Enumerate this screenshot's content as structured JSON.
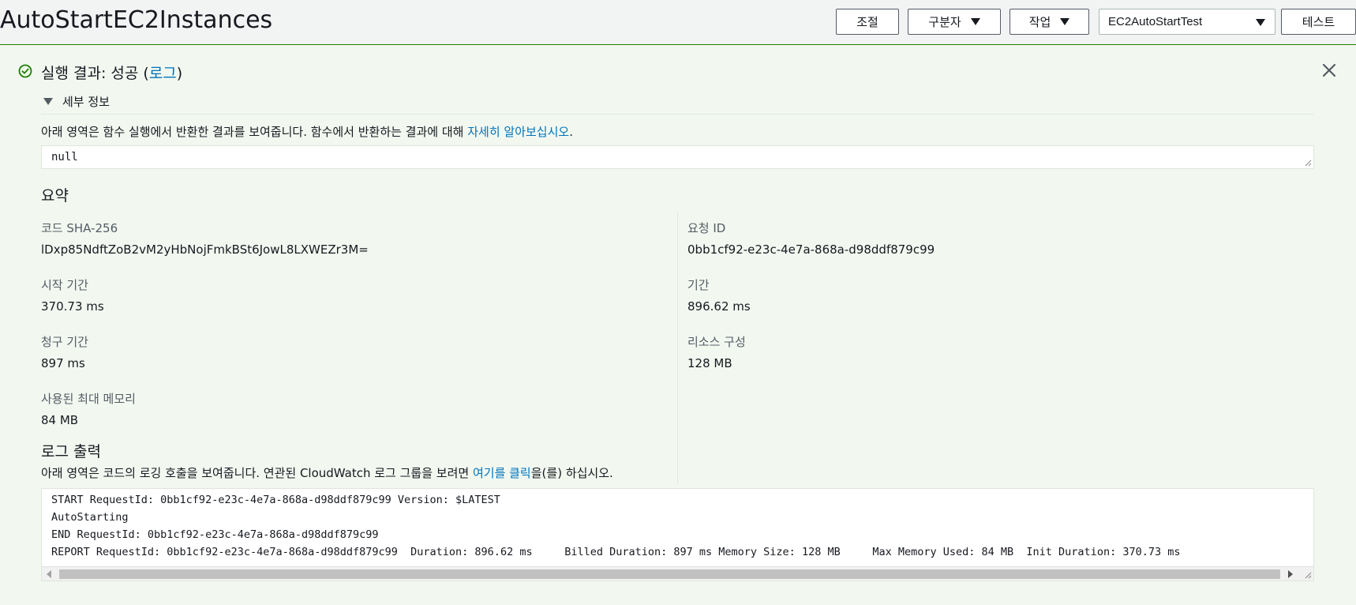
{
  "header": {
    "function_name": "AutoStartEC2Instances",
    "throttle_label": "조절",
    "qualifiers_label": "구분자",
    "actions_label": "작업",
    "test_event_value": "EC2AutoStartTest",
    "test_label": "테스트"
  },
  "result": {
    "title_prefix": "실행 결과: 성공 (",
    "log_link": "로그",
    "title_suffix": ")",
    "details_label": "세부 정보",
    "return_desc_prefix": "아래 영역은 함수 실행에서 반환한 결과를 보여줍니다. 함수에서 반환하는 결과에 대해 ",
    "return_desc_link": "자세히 알아보십시오",
    "return_desc_suffix": ".",
    "return_value": "null"
  },
  "summary": {
    "heading": "요약",
    "left": [
      {
        "label": "코드 SHA-256",
        "value": "lDxp85NdftZoB2vM2yHbNojFmkBSt6JowL8LXWEZr3M="
      },
      {
        "label": "시작 기간",
        "value": "370.73 ms"
      },
      {
        "label": "청구 기간",
        "value": "897 ms"
      },
      {
        "label": "사용된 최대 메모리",
        "value": "84 MB"
      }
    ],
    "right": [
      {
        "label": "요청 ID",
        "value": "0bb1cf92-e23c-4e7a-868a-d98ddf879c99"
      },
      {
        "label": "기간",
        "value": "896.62 ms"
      },
      {
        "label": "리소스 구성",
        "value": "128 MB"
      }
    ]
  },
  "log_output": {
    "heading": "로그 출력",
    "desc_prefix": "아래 영역은 코드의 로깅 호출을 보여줍니다. 연관된 CloudWatch 로그 그룹을 보려면 ",
    "desc_link": "여기를 클릭",
    "desc_suffix": "을(를) 하십시오.",
    "lines": [
      "START RequestId: 0bb1cf92-e23c-4e7a-868a-d98ddf879c99 Version: $LATEST",
      "AutoStarting",
      "END RequestId: 0bb1cf92-e23c-4e7a-868a-d98ddf879c99",
      "REPORT RequestId: 0bb1cf92-e23c-4e7a-868a-d98ddf879c99  Duration: 896.62 ms     Billed Duration: 897 ms Memory Size: 128 MB     Max Memory Used: 84 MB  Init Duration: 370.73 ms"
    ]
  },
  "icons": {
    "status": "check-circle-icon",
    "close": "close-icon",
    "details_toggle": "caret-down-icon"
  },
  "colors": {
    "success": "#1d8102",
    "link": "#0073bb",
    "panel_bg": "#f2f8f0"
  }
}
